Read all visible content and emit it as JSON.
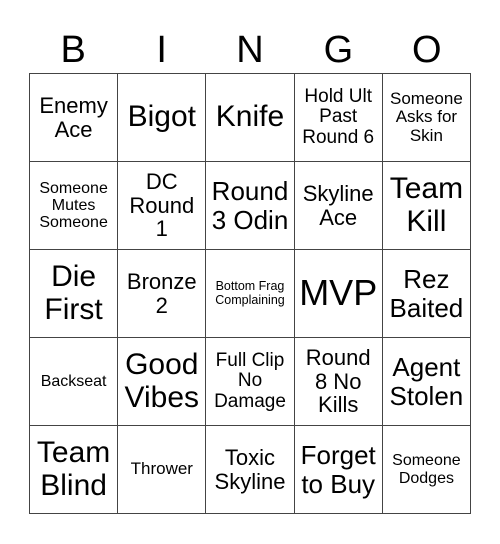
{
  "header": [
    "B",
    "I",
    "N",
    "G",
    "O"
  ],
  "cells": [
    {
      "text": "Enemy Ace",
      "lines": [
        "Enemy",
        "Ace"
      ],
      "size": "s-m"
    },
    {
      "text": "Bigot",
      "lines": [
        "Bigot"
      ],
      "size": "s-xl"
    },
    {
      "text": "Knife",
      "lines": [
        "Knife"
      ],
      "size": "s-xl"
    },
    {
      "text": "Hold Ult Past Round 6",
      "lines": [
        "Hold Ult",
        "Past",
        "Round 6"
      ],
      "size": "s-sm"
    },
    {
      "text": "Someone Asks for Skin",
      "lines": [
        "Someone",
        "Asks for",
        "Skin"
      ],
      "size": "s-s"
    },
    {
      "text": "Someone Mutes Someone",
      "lines": [
        "Someone",
        "Mutes",
        "Someone"
      ],
      "size": "s-xs"
    },
    {
      "text": "DC Round 1",
      "lines": [
        "DC",
        "Round",
        "1"
      ],
      "size": "s-m"
    },
    {
      "text": "Round 3 Odin",
      "lines": [
        "Round",
        "3 Odin"
      ],
      "size": "s-l"
    },
    {
      "text": "Skyline Ace",
      "lines": [
        "Skyline",
        "Ace"
      ],
      "size": "s-m"
    },
    {
      "text": "Team Kill",
      "lines": [
        "Team",
        "Kill"
      ],
      "size": "s-xl"
    },
    {
      "text": "Die First",
      "lines": [
        "Die",
        "First"
      ],
      "size": "s-xl"
    },
    {
      "text": "Bronze 2",
      "lines": [
        "Bronze",
        "2"
      ],
      "size": "s-m"
    },
    {
      "text": "Bottom Frag Complaining",
      "lines": [
        "Bottom Frag",
        "Complaining"
      ],
      "size": "s-xxs"
    },
    {
      "text": "MVP",
      "lines": [
        "MVP"
      ],
      "size": "s-mvp"
    },
    {
      "text": "Rez Baited",
      "lines": [
        "Rez",
        "Baited"
      ],
      "size": "s-l"
    },
    {
      "text": "Backseat",
      "lines": [
        "Backseat"
      ],
      "size": "s-xs"
    },
    {
      "text": "Good Vibes",
      "lines": [
        "Good",
        "Vibes"
      ],
      "size": "s-xl"
    },
    {
      "text": "Full Clip No Damage",
      "lines": [
        "Full Clip",
        "No",
        "Damage"
      ],
      "size": "s-sm"
    },
    {
      "text": "Round 8 No Kills",
      "lines": [
        "Round",
        "8 No",
        "Kills"
      ],
      "size": "s-m"
    },
    {
      "text": "Agent Stolen",
      "lines": [
        "Agent",
        "Stolen"
      ],
      "size": "s-l"
    },
    {
      "text": "Team Blind",
      "lines": [
        "Team",
        "Blind"
      ],
      "size": "s-xl"
    },
    {
      "text": "Thrower",
      "lines": [
        "Thrower"
      ],
      "size": "s-s"
    },
    {
      "text": "Toxic Skyline",
      "lines": [
        "Toxic",
        "Skyline"
      ],
      "size": "s-m"
    },
    {
      "text": "Forget to Buy",
      "lines": [
        "Forget",
        "to Buy"
      ],
      "size": "s-l"
    },
    {
      "text": "Someone Dodges",
      "lines": [
        "Someone",
        "Dodges"
      ],
      "size": "s-xs"
    }
  ]
}
